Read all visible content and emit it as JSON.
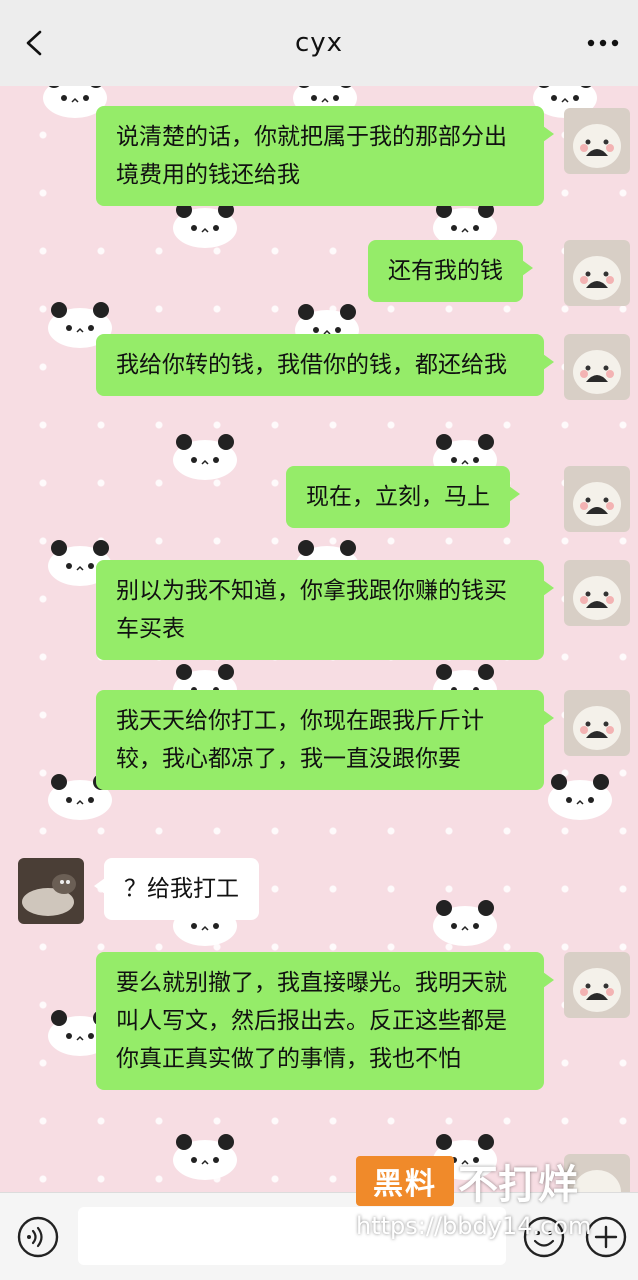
{
  "header": {
    "title": "cyx"
  },
  "messages": [
    {
      "side": "right",
      "text": "说清楚的话，你就把属于我的那部分出境费用的钱还给我"
    },
    {
      "side": "right",
      "text": "还有我的钱"
    },
    {
      "side": "right",
      "text": "我给你转的钱，我借你的钱，都还给我"
    },
    {
      "side": "right",
      "text": "现在，立刻，马上"
    },
    {
      "side": "right",
      "text": "别以为我不知道，你拿我跟你赚的钱买车买表"
    },
    {
      "side": "right",
      "text": "我天天给你打工，你现在跟我斤斤计较，我心都凉了，我一直没跟你要"
    },
    {
      "side": "left",
      "text": "？给我打工"
    },
    {
      "side": "right",
      "text": "要么就别撤了，我直接曝光。我明天就叫人写文，然后报出去。反正这些都是你真正真实做了的事情，我也不怕"
    }
  ],
  "icons": {
    "back": "chevron-left-icon",
    "more": "more-dots-icon",
    "voice": "voice-icon",
    "emoji": "emoji-icon",
    "plus": "plus-icon"
  },
  "watermark": {
    "badge": "黑料",
    "text": "不打烊",
    "url": "https://bbdy14.com"
  },
  "colors": {
    "header_bg": "#ededed",
    "chat_bg": "#f7dde3",
    "bubble_self": "#95ec69",
    "bubble_other": "#ffffff",
    "watermark_badge": "#f08a2a"
  }
}
